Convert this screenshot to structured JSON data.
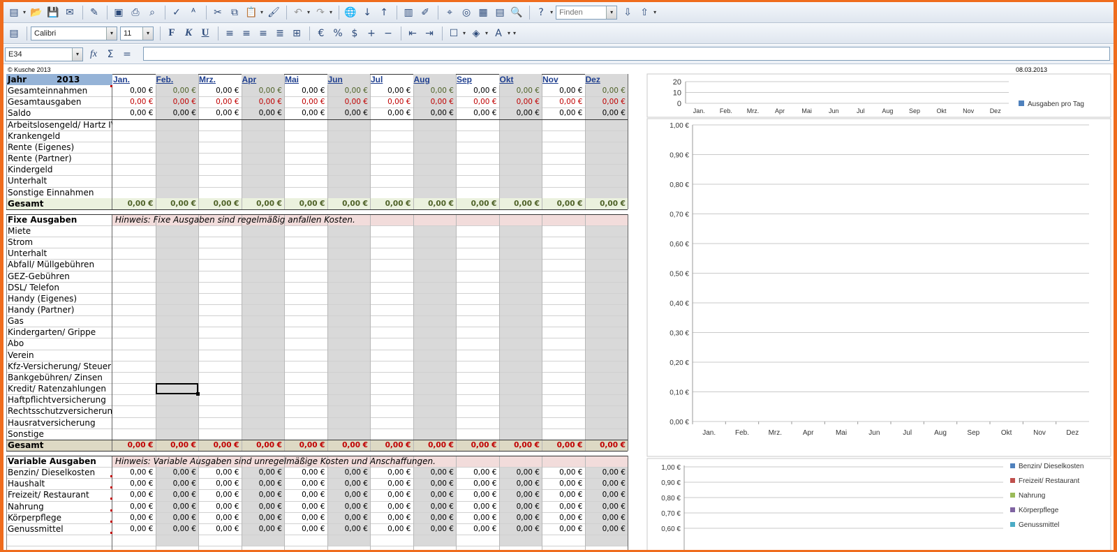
{
  "toolbar": {
    "font_name": "Calibri",
    "font_size": "11",
    "find_placeholder": "Finden",
    "bold_label": "F",
    "italic_label": "K",
    "underline_label": "U",
    "percent_label": "%"
  },
  "formula_bar": {
    "cell_ref": "E34",
    "func_label": "fx",
    "sum_label": "Σ",
    "eq_label": "="
  },
  "sheet": {
    "copyright": "© Kusche 2013",
    "date": "08.03.2013",
    "year_label": "Jahr",
    "year": "2013",
    "months": [
      "Jan.",
      "Feb.",
      "Mrz.",
      "Apr",
      "Mai",
      "Jun",
      "Jul",
      "Aug",
      "Sep",
      "Okt",
      "Nov",
      "Dez"
    ],
    "summary_rows": [
      {
        "label": "Gesamteinnahmen",
        "value": "0,00 €"
      },
      {
        "label": "Gesamtausgaben",
        "value": "0,00 €"
      },
      {
        "label": "Saldo",
        "value": "0,00 €"
      }
    ],
    "income_rows": [
      "Arbeitslosengeld/ Hartz IV",
      "Krankengeld",
      "Rente (Eigenes)",
      "Rente (Partner)",
      "Kindergeld",
      "Unterhalt",
      "Sonstige Einnahmen"
    ],
    "income_total_label": "Gesamt",
    "income_total_value": "0,00 €",
    "fixed_header": "Fixe Ausgaben",
    "fixed_hint": "Hinweis: Fixe Ausgaben sind regelmäßig anfallen Kosten.",
    "fixed_rows": [
      "Miete",
      "Strom",
      "Unterhalt",
      "Abfall/ Müllgebühren",
      "GEZ-Gebühren",
      "DSL/ Telefon",
      "Handy (Eigenes)",
      "Handy (Partner)",
      "Gas",
      "Kindergarten/ Grippe",
      "Abo",
      "Verein",
      "Kfz-Versicherung/ Steuer",
      "Bankgebühren/ Zinsen",
      "Kredit/ Ratenzahlungen",
      "Haftpflichtversicherung",
      "Rechtsschutzversicherung",
      "Hausratversicherung",
      "Sonstige"
    ],
    "fixed_total_label": "Gesamt",
    "fixed_total_value": "0,00 €",
    "variable_header": "Variable Ausgaben",
    "variable_hint": "Hinweis: Variable Ausgaben sind unregelmäßige Kosten und Anschaffungen.",
    "variable_rows": [
      "Benzin/ Dieselkosten",
      "Haushalt",
      "Freizeit/ Restaurant",
      "Nahrung",
      "Körperpflege",
      "Genussmittel"
    ],
    "variable_value": "0,00 €"
  },
  "colors": {
    "frame": "#ef6c1d",
    "header_blue": "#95b3d7",
    "total_green_bg": "#ebf1de",
    "total_beige_bg": "#ddd9c4",
    "hint_pink_bg": "#f2dcdb",
    "value_green": "#4f6228",
    "value_red": "#c00000",
    "gray_column": "#d9d9d9"
  },
  "chart_data": [
    {
      "type": "bar",
      "categories": [
        "Jan.",
        "Feb.",
        "Mrz.",
        "Apr",
        "Mai",
        "Jun",
        "Jul",
        "Aug",
        "Sep",
        "Okt",
        "Nov",
        "Dez"
      ],
      "series": [
        {
          "name": "Ausgaben pro Tag",
          "values": [
            0,
            0,
            0,
            0,
            0,
            0,
            0,
            0,
            0,
            0,
            0,
            0
          ]
        }
      ],
      "ylim": [
        0,
        20
      ],
      "yticks": [
        "20",
        "10",
        "0"
      ],
      "legend": "right"
    },
    {
      "type": "line",
      "categories": [
        "Jan.",
        "Feb.",
        "Mrz.",
        "Apr",
        "Mai",
        "Jun",
        "Jul",
        "Aug",
        "Sep",
        "Okt",
        "Nov",
        "Dez"
      ],
      "series": [],
      "ylim": [
        0,
        1
      ],
      "yticks": [
        "1,00 €",
        "0,90 €",
        "0,80 €",
        "0,70 €",
        "0,60 €",
        "0,50 €",
        "0,40 €",
        "0,30 €",
        "0,20 €",
        "0,10 €",
        "0,00 €"
      ]
    },
    {
      "type": "line",
      "series": [
        {
          "name": "Benzin/ Dieselkosten",
          "color": "#4f81bd"
        },
        {
          "name": "Freizeit/ Restaurant",
          "color": "#c0504d"
        },
        {
          "name": "Nahrung",
          "color": "#9bbb59"
        },
        {
          "name": "Körperpflege",
          "color": "#8064a2"
        },
        {
          "name": "Genussmittel",
          "color": "#4bacc6"
        }
      ],
      "yticks": [
        "1,00 €",
        "0,90 €",
        "0,80 €",
        "0,70 €",
        "0,60 €"
      ],
      "legend": "right"
    }
  ]
}
